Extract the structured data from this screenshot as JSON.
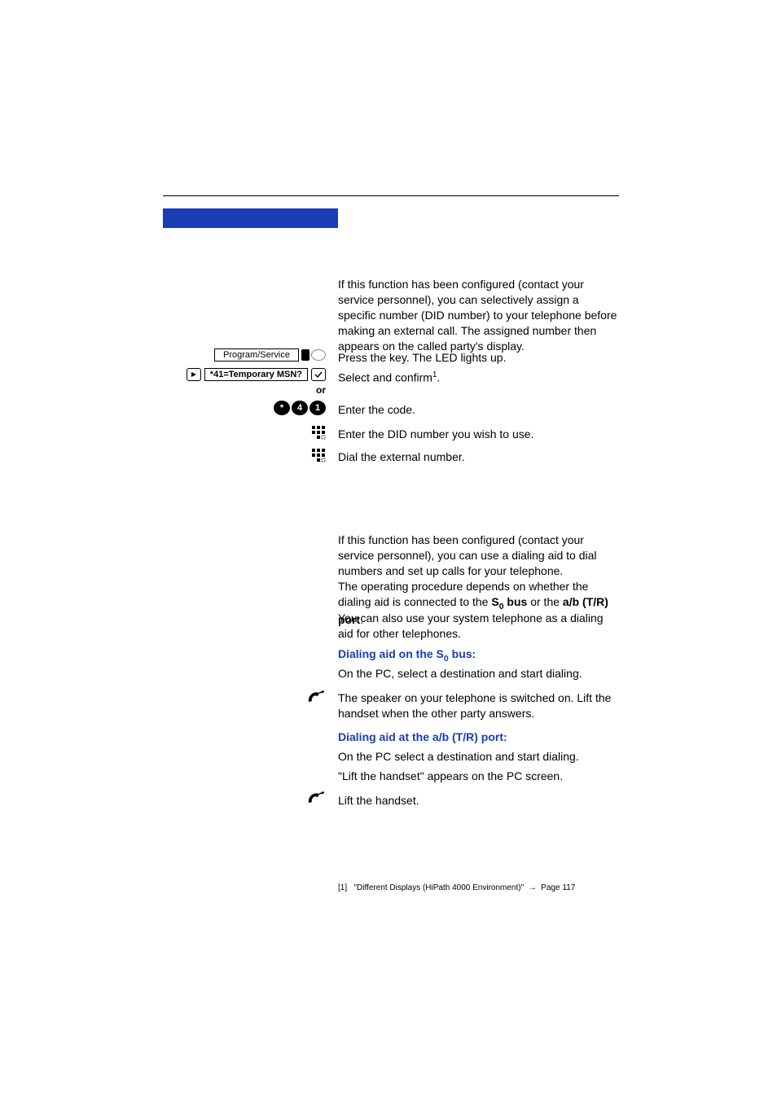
{
  "leftControls": {
    "programService": "Program/Service",
    "msnLabel": "*41=Temporary MSN?",
    "or": "or",
    "codeKeys": [
      "*",
      "4",
      "1"
    ]
  },
  "section1": {
    "intro": "If this function has been configured (contact your service personnel), you can selectively assign a specific number (DID number) to your telephone before making an external call. The assigned number then appears on the called party's display.",
    "pressKey": "Press the key. The LED lights up.",
    "selectConfirmPrefix": "Select and confirm",
    "selectConfirmSuffix": ".",
    "enterCode": "Enter the code.",
    "enterDID": "Enter the DID number you wish to use.",
    "dialExternal": "Dial the external number."
  },
  "section2": {
    "intro1": "If this function has been configured (contact your service personnel), you can use a dialing aid to dial numbers and set up calls for your telephone.",
    "intro2a": "The operating procedure depends on whether the dialing aid is connected to the ",
    "intro2b": " or the ",
    "intro2c": ".",
    "s0bus": "S",
    "s0sub": "0",
    "s0bus2": " bus",
    "abport": "a/b (T/R) port",
    "alsoUse": "You can also use your system telephone as a dialing aid for other telephones.",
    "heading1a": "Dialing aid on the S",
    "heading1b": " bus:",
    "onPCselect": "On the PC, select a destination and start dialing.",
    "speakerOn": "The speaker on your telephone is switched on. Lift the handset when the other party answers.",
    "heading2": "Dialing aid at the a/b (T/R) port:",
    "onPCselect2": "On the PC select a destination and start dialing.",
    "liftHandsetMsg": "\"Lift the handset\" appears on the PC screen.",
    "liftHandset": "Lift the handset."
  },
  "footnote": {
    "marker": "[1]",
    "text": "\"Different Displays (HiPath 4000 Environment)\"",
    "arrow": "→",
    "page": "Page 117"
  }
}
